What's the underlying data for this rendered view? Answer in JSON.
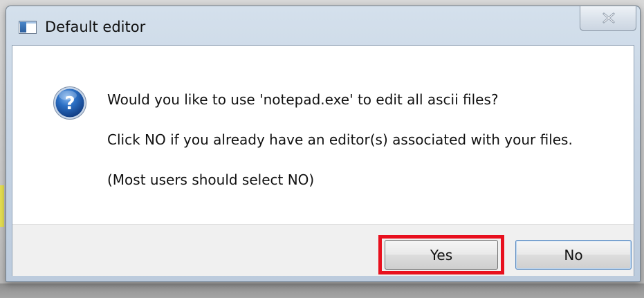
{
  "window": {
    "title": "Default editor",
    "close_label": "X"
  },
  "message": {
    "line1": "Would you like to use 'notepad.exe' to edit all ascii files?",
    "line2": "Click NO if you already have an editor(s) associated with your files.",
    "line3": "(Most users should select NO)"
  },
  "buttons": {
    "yes_label": "Yes",
    "no_label": "No"
  },
  "icons": {
    "app": "app-window-icon",
    "question": "question-icon",
    "close": "close-icon"
  },
  "colors": {
    "highlight": "#e8101e",
    "question_blue": "#1f5fb4",
    "title_gradient_top": "#d4e0ec"
  }
}
